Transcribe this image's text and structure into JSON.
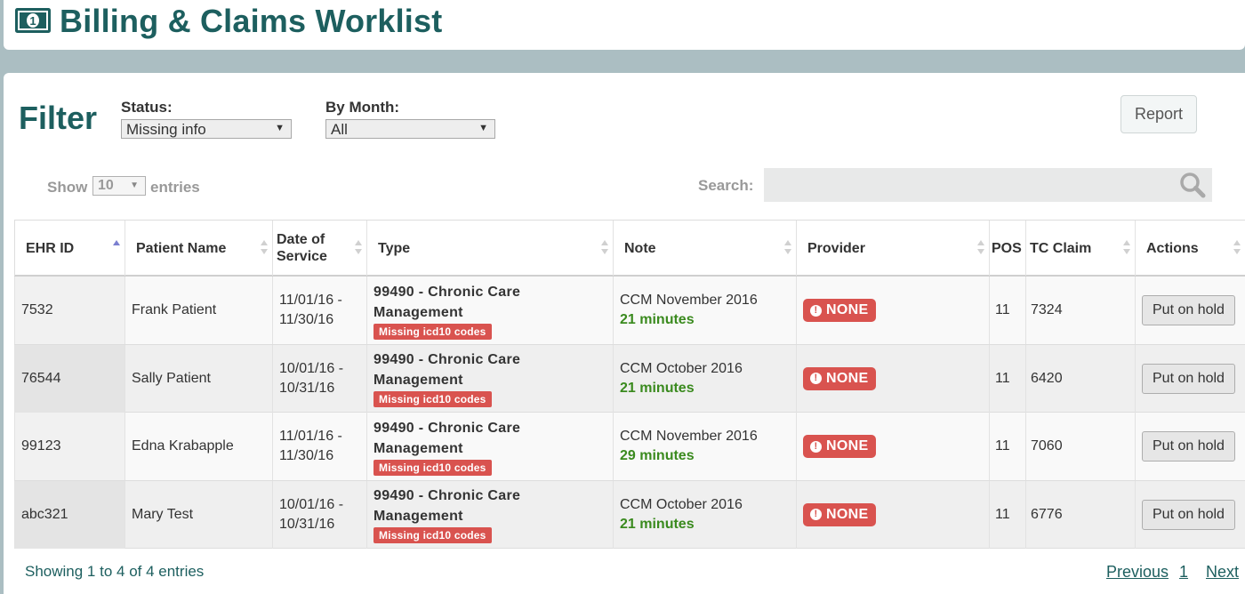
{
  "header": {
    "title": "Billing & Claims Worklist",
    "icon": "money-bill-icon"
  },
  "filter": {
    "title": "Filter",
    "status_label": "Status:",
    "status_value": "Missing info",
    "month_label": "By Month:",
    "month_value": "All",
    "report_label": "Report"
  },
  "length": {
    "show": "Show",
    "value": "10",
    "entries": "entries"
  },
  "search": {
    "label": "Search:",
    "value": ""
  },
  "table": {
    "columns": [
      "EHR ID",
      "Patient Name",
      "Date of Service",
      "Type",
      "Note",
      "Provider",
      "POS",
      "TC Claim",
      "Actions"
    ],
    "rows": [
      {
        "ehr_id": "7532",
        "patient": "Frank Patient",
        "dos": "11/01/16 - 11/30/16",
        "type": "99490 - Chronic Care Management",
        "type_badge": "Missing icd10 codes",
        "note": "CCM November 2016",
        "minutes": "21 minutes",
        "provider": "NONE",
        "pos": "11",
        "tc_claim": "7324",
        "action": "Put on hold"
      },
      {
        "ehr_id": "76544",
        "patient": "Sally Patient",
        "dos": "10/01/16 - 10/31/16",
        "type": "99490 - Chronic Care Management",
        "type_badge": "Missing icd10 codes",
        "note": "CCM October 2016",
        "minutes": "21 minutes",
        "provider": "NONE",
        "pos": "11",
        "tc_claim": "6420",
        "action": "Put on hold"
      },
      {
        "ehr_id": "99123",
        "patient": "Edna Krabapple",
        "dos": "11/01/16 - 11/30/16",
        "type": "99490 - Chronic Care Management",
        "type_badge": "Missing icd10 codes",
        "note": "CCM November 2016",
        "minutes": "29 minutes",
        "provider": "NONE",
        "pos": "11",
        "tc_claim": "7060",
        "action": "Put on hold"
      },
      {
        "ehr_id": "abc321",
        "patient": "Mary Test",
        "dos": "10/01/16 - 10/31/16",
        "type": "99490 - Chronic Care Management",
        "type_badge": "Missing icd10 codes",
        "note": "CCM October 2016",
        "minutes": "21 minutes",
        "provider": "NONE",
        "pos": "11",
        "tc_claim": "6776",
        "action": "Put on hold"
      }
    ]
  },
  "footer": {
    "info": "Showing 1 to 4 of 4 entries",
    "previous": "Previous",
    "page": "1",
    "next": "Next"
  },
  "colors": {
    "brand": "#1d5f5f",
    "danger": "#d9534f",
    "success": "#3a8a1e",
    "backdrop": "#abbec2"
  }
}
